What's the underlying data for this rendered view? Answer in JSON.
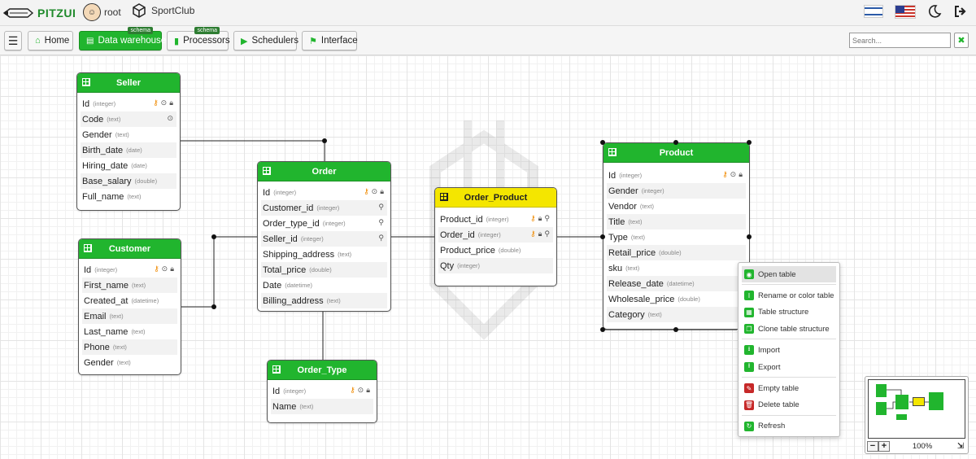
{
  "app": {
    "logo_text": "PITZUI",
    "user": "root",
    "project": "SportClub"
  },
  "toolbar": {
    "home": "Home",
    "data_warehouse": "Data warehouse",
    "processors": "Processors",
    "schedulers": "Schedulers",
    "interface": "Interface",
    "badge": "schema"
  },
  "search": {
    "placeholder": "Search...",
    "clear": "✖"
  },
  "tables": {
    "seller": {
      "title": "Seller",
      "rows": [
        {
          "name": "Id",
          "type": "(integer)"
        },
        {
          "name": "Code",
          "type": "(text)"
        },
        {
          "name": "Gender",
          "type": "(text)"
        },
        {
          "name": "Birth_date",
          "type": "(date)"
        },
        {
          "name": "Hiring_date",
          "type": "(date)"
        },
        {
          "name": "Base_salary",
          "type": "(double)"
        },
        {
          "name": "Full_name",
          "type": "(text)"
        }
      ]
    },
    "customer": {
      "title": "Customer",
      "rows": [
        {
          "name": "Id",
          "type": "(integer)"
        },
        {
          "name": "First_name",
          "type": "(text)"
        },
        {
          "name": "Created_at",
          "type": "(datetime)"
        },
        {
          "name": "Email",
          "type": "(text)"
        },
        {
          "name": "Last_name",
          "type": "(text)"
        },
        {
          "name": "Phone",
          "type": "(text)"
        },
        {
          "name": "Gender",
          "type": "(text)"
        }
      ]
    },
    "order": {
      "title": "Order",
      "rows": [
        {
          "name": "Id",
          "type": "(integer)"
        },
        {
          "name": "Customer_id",
          "type": "(integer)"
        },
        {
          "name": "Order_type_id",
          "type": "(integer)"
        },
        {
          "name": "Seller_id",
          "type": "(integer)"
        },
        {
          "name": "Shipping_address",
          "type": "(text)"
        },
        {
          "name": "Total_price",
          "type": "(double)"
        },
        {
          "name": "Date",
          "type": "(datetime)"
        },
        {
          "name": "Billing_address",
          "type": "(text)"
        }
      ]
    },
    "order_type": {
      "title": "Order_Type",
      "rows": [
        {
          "name": "Id",
          "type": "(integer)"
        },
        {
          "name": "Name",
          "type": "(text)"
        }
      ]
    },
    "order_product": {
      "title": "Order_Product",
      "rows": [
        {
          "name": "Product_id",
          "type": "(integer)"
        },
        {
          "name": "Order_id",
          "type": "(integer)"
        },
        {
          "name": "Product_price",
          "type": "(double)"
        },
        {
          "name": "Qty",
          "type": "(integer)"
        }
      ]
    },
    "product": {
      "title": "Product",
      "rows": [
        {
          "name": "Id",
          "type": "(integer)"
        },
        {
          "name": "Gender",
          "type": "(integer)"
        },
        {
          "name": "Vendor",
          "type": "(text)"
        },
        {
          "name": "Title",
          "type": "(text)"
        },
        {
          "name": "Type",
          "type": "(text)"
        },
        {
          "name": "Retail_price",
          "type": "(double)"
        },
        {
          "name": "sku",
          "type": "(text)"
        },
        {
          "name": "Release_date",
          "type": "(datetime)"
        },
        {
          "name": "Wholesale_price",
          "type": "(double)"
        },
        {
          "name": "Category",
          "type": "(text)"
        }
      ]
    }
  },
  "context_menu": {
    "open_table": "Open table",
    "rename": "Rename or color table",
    "structure": "Table structure",
    "clone": "Clone table structure",
    "import": "Import",
    "export": "Export",
    "empty": "Empty table",
    "delete": "Delete table",
    "refresh": "Refresh"
  },
  "minimap": {
    "zoom": "100%",
    "minus": "−",
    "plus": "+"
  },
  "colors": {
    "accent": "#21b52e",
    "highlight_table": "#f4e600",
    "danger": "#c62828"
  }
}
